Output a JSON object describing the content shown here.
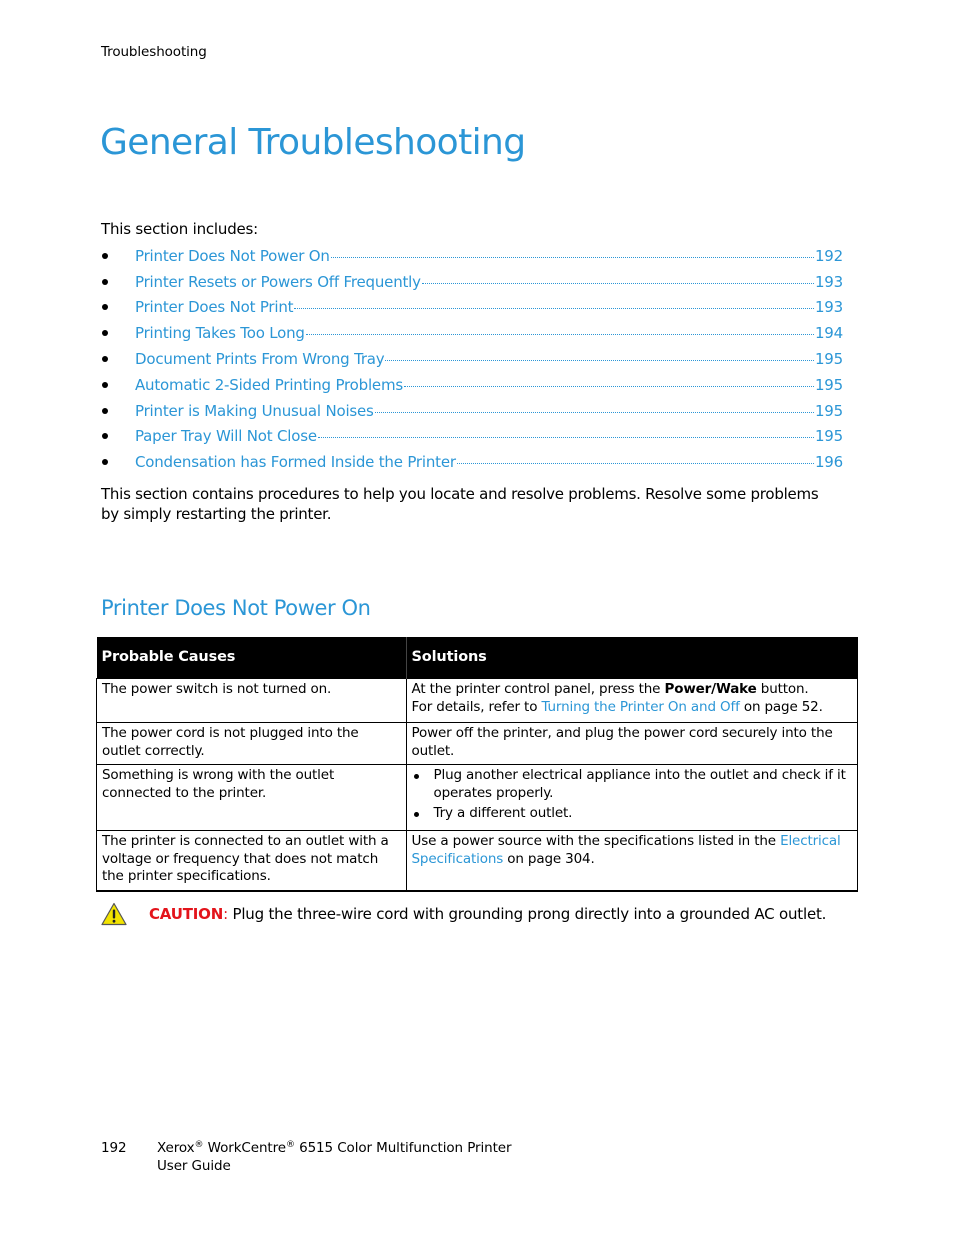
{
  "header": {
    "running_title": "Troubleshooting"
  },
  "title": "General Troubleshooting",
  "intro": "This section includes:",
  "toc": [
    {
      "label": "Printer Does Not Power On",
      "page": "192"
    },
    {
      "label": "Printer Resets or Powers Off Frequently",
      "page": "193"
    },
    {
      "label": "Printer Does Not Print",
      "page": "193"
    },
    {
      "label": "Printing Takes Too Long",
      "page": "194"
    },
    {
      "label": "Document Prints From Wrong Tray",
      "page": "195"
    },
    {
      "label": "Automatic 2-Sided Printing Problems",
      "page": "195"
    },
    {
      "label": "Printer is Making Unusual Noises",
      "page": "195"
    },
    {
      "label": "Paper Tray Will Not Close",
      "page": "195"
    },
    {
      "label": "Condensation has Formed Inside the Printer",
      "page": "196"
    }
  ],
  "summary": "This section contains procedures to help you locate and resolve problems. Resolve some problems by simply restarting the printer.",
  "section": {
    "heading": "Printer Does Not Power On",
    "table": {
      "headers": {
        "causes": "Probable Causes",
        "solutions": "Solutions"
      },
      "rows": [
        {
          "cause": "The power switch is not turned on.",
          "solution": {
            "line1_pre": "At the printer control panel, press the ",
            "line1_bold": "Power/Wake",
            "line1_post": " button.",
            "line2_pre": "For details, refer to ",
            "line2_link": "Turning the Printer On and Off",
            "line2_post": " on page 52."
          }
        },
        {
          "cause": "The power cord is not plugged into the outlet correctly.",
          "solution": {
            "text": "Power off the printer, and plug the power cord securely into the outlet."
          }
        },
        {
          "cause": "Something is wrong with the outlet connected to the printer.",
          "solution": {
            "bullets": [
              "Plug another electrical appliance into the outlet and check if it operates properly.",
              "Try a different outlet."
            ]
          }
        },
        {
          "cause": "The printer is connected to an outlet with a voltage or frequency that does not match the printer specifications.",
          "solution": {
            "pre": "Use a power source with the specifications listed in the ",
            "link": "Electrical Specifications",
            "post": " on page 304."
          }
        }
      ]
    }
  },
  "caution": {
    "icon": "warning-triangle-icon",
    "label": "CAUTION",
    "colon": ":",
    "text": " Plug the three-wire cord with grounding prong directly into a grounded AC outlet."
  },
  "footer": {
    "page_number": "192",
    "brand": "Xerox",
    "reg": "®",
    "product": " WorkCentre",
    "reg2": "®",
    "model": " 6515 Color Multifunction Printer",
    "doc_type": "User Guide"
  },
  "colors": {
    "link": "#2b96d6",
    "caution": "#e3141b",
    "table_header_bg": "#000000",
    "warning_icon_fill": "#f2e300"
  }
}
